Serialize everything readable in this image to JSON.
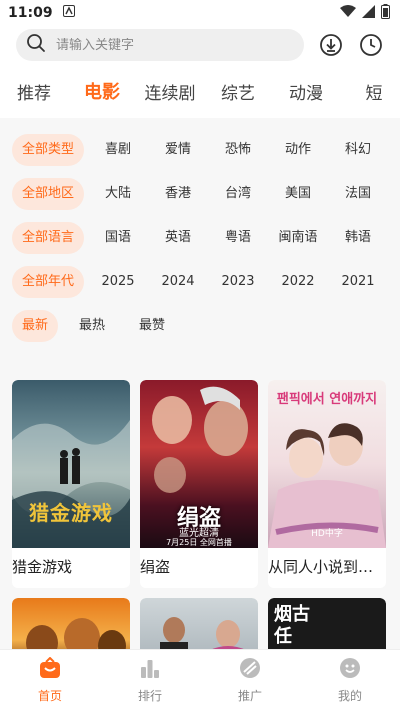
{
  "status": {
    "time": "11:09"
  },
  "search": {
    "placeholder": "请输入关键字"
  },
  "tabs": [
    "推荐",
    "电影",
    "连续剧",
    "综艺",
    "动漫",
    "短"
  ],
  "filters": {
    "type": [
      "全部类型",
      "喜剧",
      "爱情",
      "恐怖",
      "动作",
      "科幻"
    ],
    "region": [
      "全部地区",
      "大陆",
      "香港",
      "台湾",
      "美国",
      "法国"
    ],
    "language": [
      "全部语言",
      "国语",
      "英语",
      "粤语",
      "闽南语",
      "韩语"
    ],
    "year": [
      "全部年代",
      "2025",
      "2024",
      "2023",
      "2022",
      "2021"
    ],
    "sort": [
      "最新",
      "最热",
      "最赞"
    ]
  },
  "movies": [
    {
      "title": "猎金游戏",
      "poster_text": "猎金游戏"
    },
    {
      "title": "绢盗",
      "poster_text": "绢盗",
      "poster_sub": "蓝光超清",
      "poster_date": "7月25日 全网首播"
    },
    {
      "title": "从同人小说到…",
      "poster_text": "팬픽에서 연애까지",
      "poster_badge": "HD中字"
    }
  ],
  "movies_row2": [
    {
      "poster_text": ""
    },
    {
      "poster_text": ""
    },
    {
      "poster_text": "烟古 任"
    }
  ],
  "bottom_nav": [
    "首页",
    "排行",
    "推广",
    "我的"
  ],
  "colors": {
    "accent": "#ff6a1a",
    "chip_bg": "#fde7dc"
  }
}
